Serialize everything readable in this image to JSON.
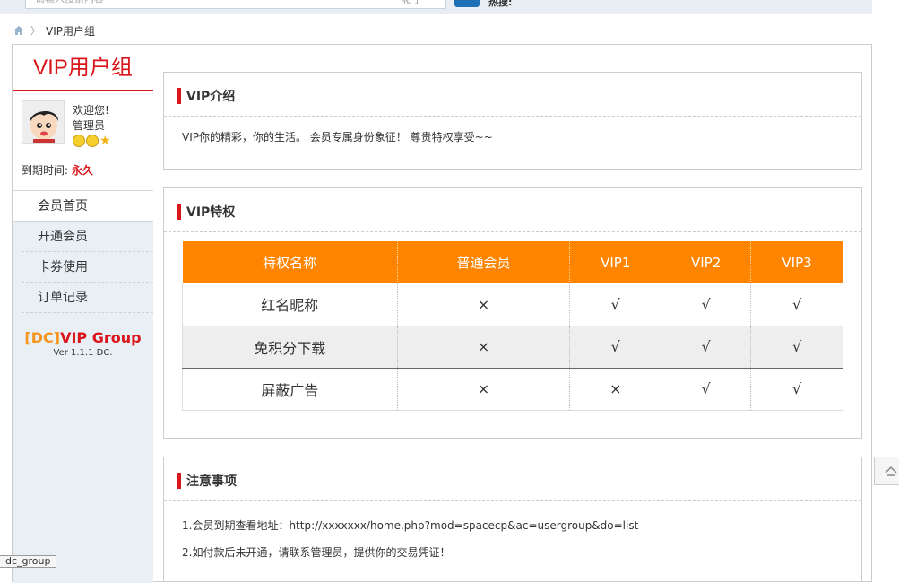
{
  "topbar": {
    "search_placeholder": "请输入搜索内容",
    "search_type": "帖子",
    "hot_label": "热搜:"
  },
  "breadcrumb": {
    "current": "VIP用户组"
  },
  "sidebar": {
    "title": "VIP用户组",
    "welcome": "欢迎您!",
    "username": "管理员",
    "expire_label": "到期时间:",
    "expire_value": "永久",
    "menu": [
      {
        "label": "会员首页",
        "active": true
      },
      {
        "label": "开通会员"
      },
      {
        "label": "卡券使用"
      },
      {
        "label": "订单记录"
      }
    ],
    "brand_dc": "[DC]",
    "brand_name": "VIP Group",
    "version": "Ver 1.1.1 DC."
  },
  "intro": {
    "title": "VIP介绍",
    "text": "VIP你的精彩，你的生活。 会员专属身份象征！ 尊贵特权享受~~"
  },
  "privileges": {
    "title": "VIP特权",
    "headers": [
      "特权名称",
      "普通会员",
      "VIP1",
      "VIP2",
      "VIP3"
    ],
    "rows": [
      [
        "红名昵称",
        "×",
        "√",
        "√",
        "√"
      ],
      [
        "免积分下载",
        "×",
        "√",
        "√",
        "√"
      ],
      [
        "屏蔽广告",
        "×",
        "×",
        "√",
        "√"
      ]
    ]
  },
  "notes": {
    "title": "注意事项",
    "items": [
      "1.会员到期查看地址：http://xxxxxxx/home.php?mod=spacecp&ac=usergroup&do=list",
      "2.如付款后未开通，请联系管理员，提供你的交易凭证！"
    ]
  },
  "status_tip": "dc_group",
  "colors": {
    "accent_red": "#d9161b",
    "table_header": "#ff8500",
    "sidebar_bg": "#e8f0f6"
  }
}
